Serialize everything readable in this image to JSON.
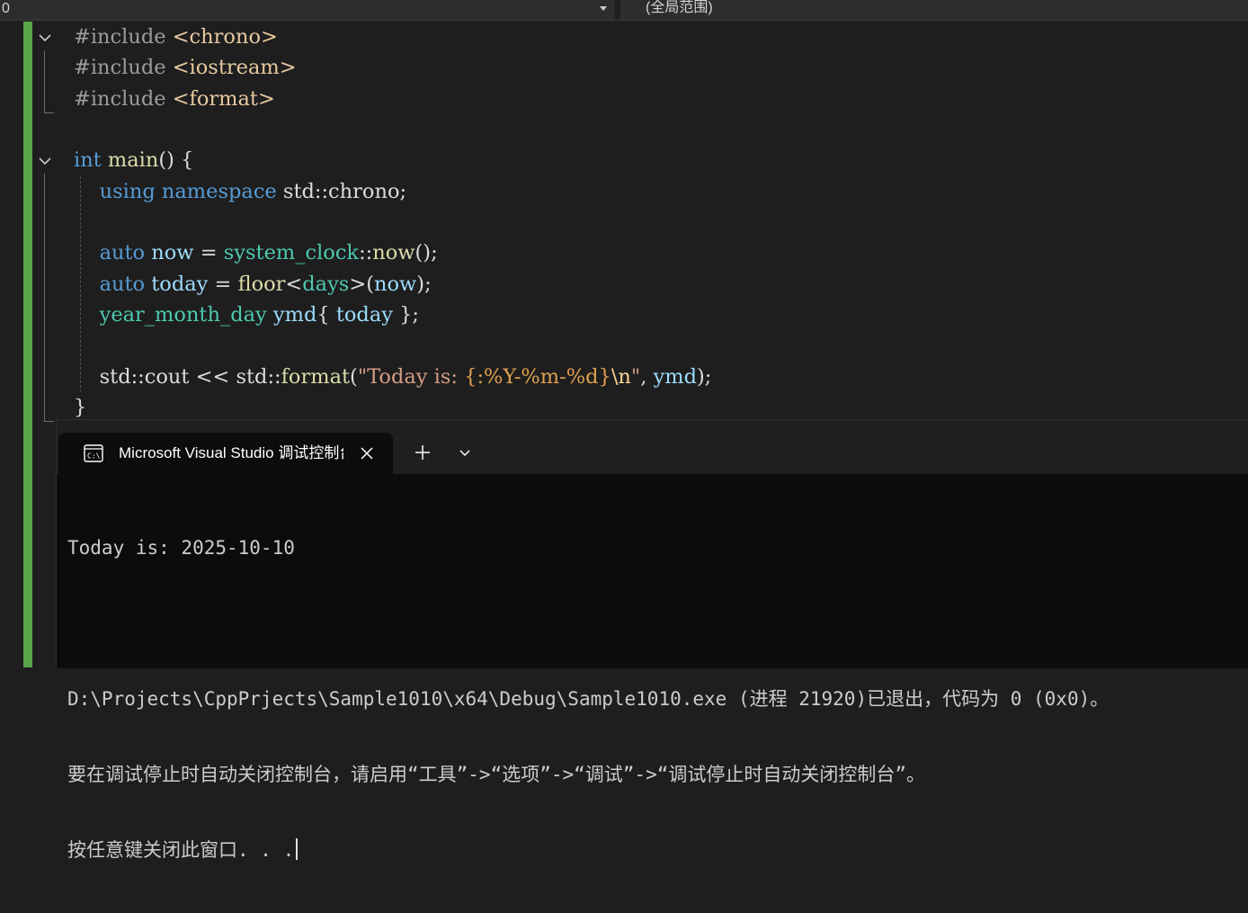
{
  "navbar": {
    "left_value": "0",
    "right_value": "(全局范围)"
  },
  "code": {
    "lines": [
      {
        "parts": [
          {
            "t": "#include ",
            "c": "pp"
          },
          {
            "t": "<chrono>",
            "c": "inc"
          }
        ]
      },
      {
        "parts": [
          {
            "t": "#include ",
            "c": "pp"
          },
          {
            "t": "<iostream>",
            "c": "inc"
          }
        ]
      },
      {
        "parts": [
          {
            "t": "#include ",
            "c": "pp"
          },
          {
            "t": "<format>",
            "c": "inc"
          }
        ]
      },
      {
        "parts": []
      },
      {
        "parts": [
          {
            "t": "int",
            "c": "kw"
          },
          {
            "t": " "
          },
          {
            "t": "main",
            "c": "fn"
          },
          {
            "t": "() {"
          }
        ]
      },
      {
        "parts": [
          {
            "t": "    "
          },
          {
            "t": "using",
            "c": "kw"
          },
          {
            "t": " "
          },
          {
            "t": "namespace",
            "c": "kw"
          },
          {
            "t": " std::chrono;"
          }
        ]
      },
      {
        "parts": []
      },
      {
        "parts": [
          {
            "t": "    "
          },
          {
            "t": "auto",
            "c": "kw"
          },
          {
            "t": " "
          },
          {
            "t": "now",
            "c": "var"
          },
          {
            "t": " = "
          },
          {
            "t": "system_clock",
            "c": "ty"
          },
          {
            "t": "::"
          },
          {
            "t": "now",
            "c": "fn"
          },
          {
            "t": "();"
          }
        ]
      },
      {
        "parts": [
          {
            "t": "    "
          },
          {
            "t": "auto",
            "c": "kw"
          },
          {
            "t": " "
          },
          {
            "t": "today",
            "c": "var"
          },
          {
            "t": " = "
          },
          {
            "t": "floor",
            "c": "fn"
          },
          {
            "t": "<"
          },
          {
            "t": "days",
            "c": "ty"
          },
          {
            "t": ">("
          },
          {
            "t": "now",
            "c": "var"
          },
          {
            "t": ");"
          }
        ]
      },
      {
        "parts": [
          {
            "t": "    "
          },
          {
            "t": "year_month_day",
            "c": "ty"
          },
          {
            "t": " "
          },
          {
            "t": "ymd",
            "c": "var"
          },
          {
            "t": "{ "
          },
          {
            "t": "today",
            "c": "var"
          },
          {
            "t": " };"
          }
        ]
      },
      {
        "parts": []
      },
      {
        "parts": [
          {
            "t": "    std::cout << std::"
          },
          {
            "t": "format",
            "c": "fn"
          },
          {
            "t": "("
          },
          {
            "t": "\"Today is: ",
            "c": "str"
          },
          {
            "t": "{:%Y-%m-%d}",
            "c": "fmt"
          },
          {
            "t": "\\n",
            "c": "esc"
          },
          {
            "t": "\"",
            "c": "str"
          },
          {
            "t": ", "
          },
          {
            "t": "ymd",
            "c": "var"
          },
          {
            "t": ");"
          }
        ]
      },
      {
        "parts": [
          {
            "t": "}"
          }
        ]
      }
    ]
  },
  "terminal": {
    "tab_title": "Microsoft Visual Studio 调试控制台",
    "new_tab_label": "+",
    "output": [
      "Today is: 2025-10-10",
      "",
      "D:\\Projects\\CppPrjects\\Sample1010\\x64\\Debug\\Sample1010.exe (进程 21920)已退出，代码为 0 (0x0)。",
      "要在调试停止时自动关闭控制台，请启用“工具”->“选项”->“调试”->“调试停止时自动关闭控制台”。",
      "按任意键关闭此窗口. . ."
    ]
  },
  "colors": {
    "keyword": "#569cd6",
    "function": "#dcdcaa",
    "type": "#4ec9b0",
    "variable": "#9cdcfe",
    "string": "#d69d85",
    "change_bar": "#57a64a"
  },
  "icons": [
    "chevron-down-icon",
    "console-icon",
    "close-icon",
    "plus-icon"
  ]
}
